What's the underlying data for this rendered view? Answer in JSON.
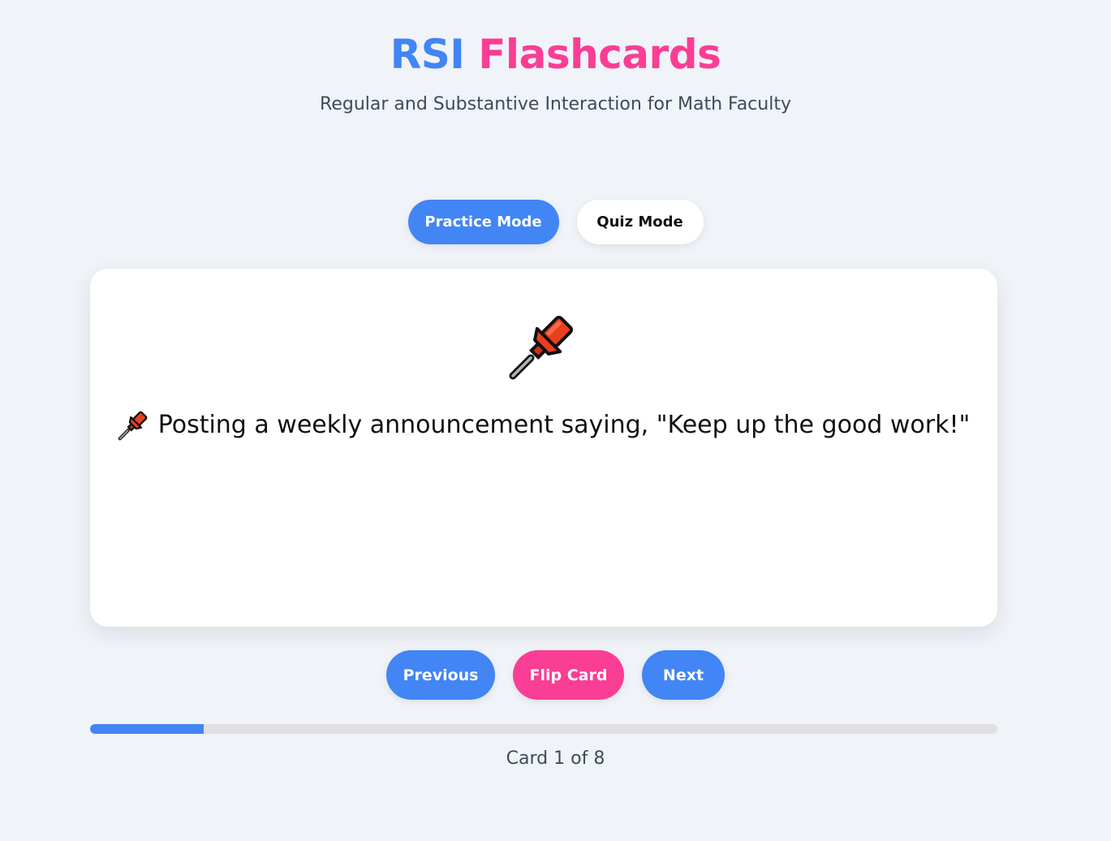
{
  "header": {
    "title_part1": "RSI",
    "title_part2": "Flashcards",
    "subtitle": "Regular and Substantive Interaction for Math Faculty",
    "colors": {
      "part1": "#4285f4",
      "part2": "#fa3d95"
    }
  },
  "modes": {
    "practice_label": "Practice Mode",
    "quiz_label": "Quiz Mode",
    "active": "practice"
  },
  "card": {
    "icon": "pushpin-icon",
    "text": "Posting a weekly announcement saying, \"Keep up the good work!\""
  },
  "navigation": {
    "previous_label": "Previous",
    "flip_label": "Flip Card",
    "next_label": "Next"
  },
  "progress": {
    "current": 1,
    "total": 8,
    "fraction": 0.125,
    "label": "Card 1 of 8"
  },
  "colors": {
    "accent_blue": "#4285f4",
    "accent_pink": "#fa3d95",
    "background": "#f0f3f8"
  }
}
